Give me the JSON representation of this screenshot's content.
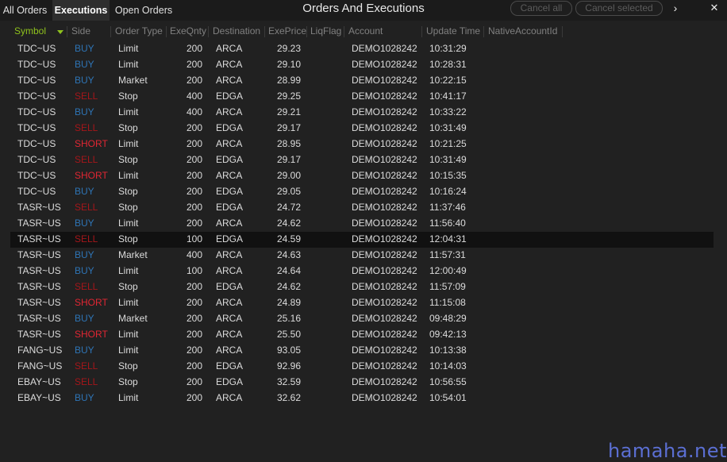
{
  "tabs": [
    {
      "label": "All Orders"
    },
    {
      "label": "Executions"
    },
    {
      "label": "Open Orders"
    }
  ],
  "window_title": "Orders And Executions",
  "toolbar": {
    "cancel_all": "Cancel all",
    "cancel_selected": "Cancel selected",
    "expand_icon": "›",
    "close_icon": "✕"
  },
  "columns": {
    "symbol": "Symbol",
    "side": "Side",
    "order_type": "Order Type",
    "exe_qnty": "ExeQnty",
    "destination": "Destination",
    "exe_price": "ExePrice",
    "liq_flag": "LiqFlag",
    "account": "Account",
    "update_time": "Update Time",
    "native_account_id": "NativeAccountId"
  },
  "colors": {
    "buy": "#2e74b5",
    "sell": "#a4161a",
    "short": "#e02633",
    "sort_indicator": "#8fc21d",
    "watermark": "#5b6fd3"
  },
  "rows": [
    {
      "symbol": "TDC~US",
      "side": "BUY",
      "type": "Limit",
      "qty": "200",
      "dest": "ARCA",
      "price": "29.23",
      "account": "DEMO1028242",
      "time": "10:31:29"
    },
    {
      "symbol": "TDC~US",
      "side": "BUY",
      "type": "Limit",
      "qty": "200",
      "dest": "ARCA",
      "price": "29.10",
      "account": "DEMO1028242",
      "time": "10:28:31"
    },
    {
      "symbol": "TDC~US",
      "side": "BUY",
      "type": "Market",
      "qty": "200",
      "dest": "ARCA",
      "price": "28.99",
      "account": "DEMO1028242",
      "time": "10:22:15"
    },
    {
      "symbol": "TDC~US",
      "side": "SELL",
      "type": "Stop",
      "qty": "400",
      "dest": "EDGA",
      "price": "29.25",
      "account": "DEMO1028242",
      "time": "10:41:17"
    },
    {
      "symbol": "TDC~US",
      "side": "BUY",
      "type": "Limit",
      "qty": "400",
      "dest": "ARCA",
      "price": "29.21",
      "account": "DEMO1028242",
      "time": "10:33:22"
    },
    {
      "symbol": "TDC~US",
      "side": "SELL",
      "type": "Stop",
      "qty": "200",
      "dest": "EDGA",
      "price": "29.17",
      "account": "DEMO1028242",
      "time": "10:31:49"
    },
    {
      "symbol": "TDC~US",
      "side": "SHORT",
      "type": "Limit",
      "qty": "200",
      "dest": "ARCA",
      "price": "28.95",
      "account": "DEMO1028242",
      "time": "10:21:25"
    },
    {
      "symbol": "TDC~US",
      "side": "SELL",
      "type": "Stop",
      "qty": "200",
      "dest": "EDGA",
      "price": "29.17",
      "account": "DEMO1028242",
      "time": "10:31:49"
    },
    {
      "symbol": "TDC~US",
      "side": "SHORT",
      "type": "Limit",
      "qty": "200",
      "dest": "ARCA",
      "price": "29.00",
      "account": "DEMO1028242",
      "time": "10:15:35"
    },
    {
      "symbol": "TDC~US",
      "side": "BUY",
      "type": "Stop",
      "qty": "200",
      "dest": "EDGA",
      "price": "29.05",
      "account": "DEMO1028242",
      "time": "10:16:24"
    },
    {
      "symbol": "TASR~US",
      "side": "SELL",
      "type": "Stop",
      "qty": "200",
      "dest": "EDGA",
      "price": "24.72",
      "account": "DEMO1028242",
      "time": "11:37:46"
    },
    {
      "symbol": "TASR~US",
      "side": "BUY",
      "type": "Limit",
      "qty": "200",
      "dest": "ARCA",
      "price": "24.62",
      "account": "DEMO1028242",
      "time": "11:56:40"
    },
    {
      "symbol": "TASR~US",
      "side": "SELL",
      "type": "Stop",
      "qty": "100",
      "dest": "EDGA",
      "price": "24.59",
      "account": "DEMO1028242",
      "time": "12:04:31",
      "selected": true
    },
    {
      "symbol": "TASR~US",
      "side": "BUY",
      "type": "Market",
      "qty": "400",
      "dest": "ARCA",
      "price": "24.63",
      "account": "DEMO1028242",
      "time": "11:57:31"
    },
    {
      "symbol": "TASR~US",
      "side": "BUY",
      "type": "Limit",
      "qty": "100",
      "dest": "ARCA",
      "price": "24.64",
      "account": "DEMO1028242",
      "time": "12:00:49"
    },
    {
      "symbol": "TASR~US",
      "side": "SELL",
      "type": "Stop",
      "qty": "200",
      "dest": "EDGA",
      "price": "24.62",
      "account": "DEMO1028242",
      "time": "11:57:09"
    },
    {
      "symbol": "TASR~US",
      "side": "SHORT",
      "type": "Limit",
      "qty": "200",
      "dest": "ARCA",
      "price": "24.89",
      "account": "DEMO1028242",
      "time": "11:15:08"
    },
    {
      "symbol": "TASR~US",
      "side": "BUY",
      "type": "Market",
      "qty": "200",
      "dest": "ARCA",
      "price": "25.16",
      "account": "DEMO1028242",
      "time": "09:48:29"
    },
    {
      "symbol": "TASR~US",
      "side": "SHORT",
      "type": "Limit",
      "qty": "200",
      "dest": "ARCA",
      "price": "25.50",
      "account": "DEMO1028242",
      "time": "09:42:13"
    },
    {
      "symbol": "FANG~US",
      "side": "BUY",
      "type": "Limit",
      "qty": "200",
      "dest": "ARCA",
      "price": "93.05",
      "account": "DEMO1028242",
      "time": "10:13:38"
    },
    {
      "symbol": "FANG~US",
      "side": "SELL",
      "type": "Stop",
      "qty": "200",
      "dest": "EDGA",
      "price": "92.96",
      "account": "DEMO1028242",
      "time": "10:14:03"
    },
    {
      "symbol": "EBAY~US",
      "side": "SELL",
      "type": "Stop",
      "qty": "200",
      "dest": "EDGA",
      "price": "32.59",
      "account": "DEMO1028242",
      "time": "10:56:55"
    },
    {
      "symbol": "EBAY~US",
      "side": "BUY",
      "type": "Limit",
      "qty": "200",
      "dest": "ARCA",
      "price": "32.62",
      "account": "DEMO1028242",
      "time": "10:54:01"
    }
  ],
  "watermark": "hamaha.net"
}
